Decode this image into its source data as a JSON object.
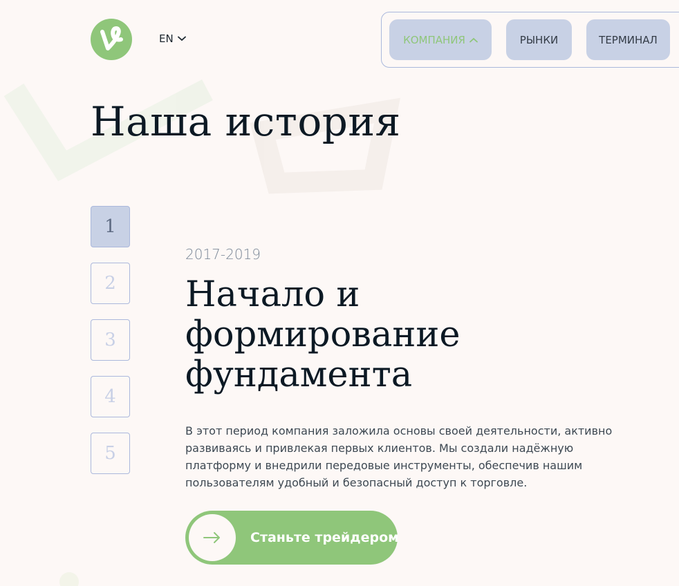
{
  "brand": {
    "logo_icon": "vine-logo-icon",
    "accent_color": "#8fc67a"
  },
  "header": {
    "language": "EN",
    "nav": [
      {
        "label": "КОМПАНИЯ",
        "active": true
      },
      {
        "label": "РЫНКИ",
        "active": false
      },
      {
        "label": "ТЕРМИНАЛ",
        "active": false
      }
    ]
  },
  "main": {
    "title": "Наша история",
    "steps": [
      "1",
      "2",
      "3",
      "4",
      "5"
    ],
    "active_step": "1",
    "period": "2017-2019",
    "section_title_lines": [
      "Начало и",
      "формирование",
      "фундамента"
    ],
    "description_lines": [
      "В этот период компания заложила основы своей деятельности, активно",
      "развиваясь и привлекая первых клиентов. Мы создали надёжную",
      "платформу и внедрили передовые инструменты, обеспечив нашим",
      "пользователям удобный и безопасный доступ к торговле."
    ],
    "cta_label": "Станьте трейдером"
  }
}
